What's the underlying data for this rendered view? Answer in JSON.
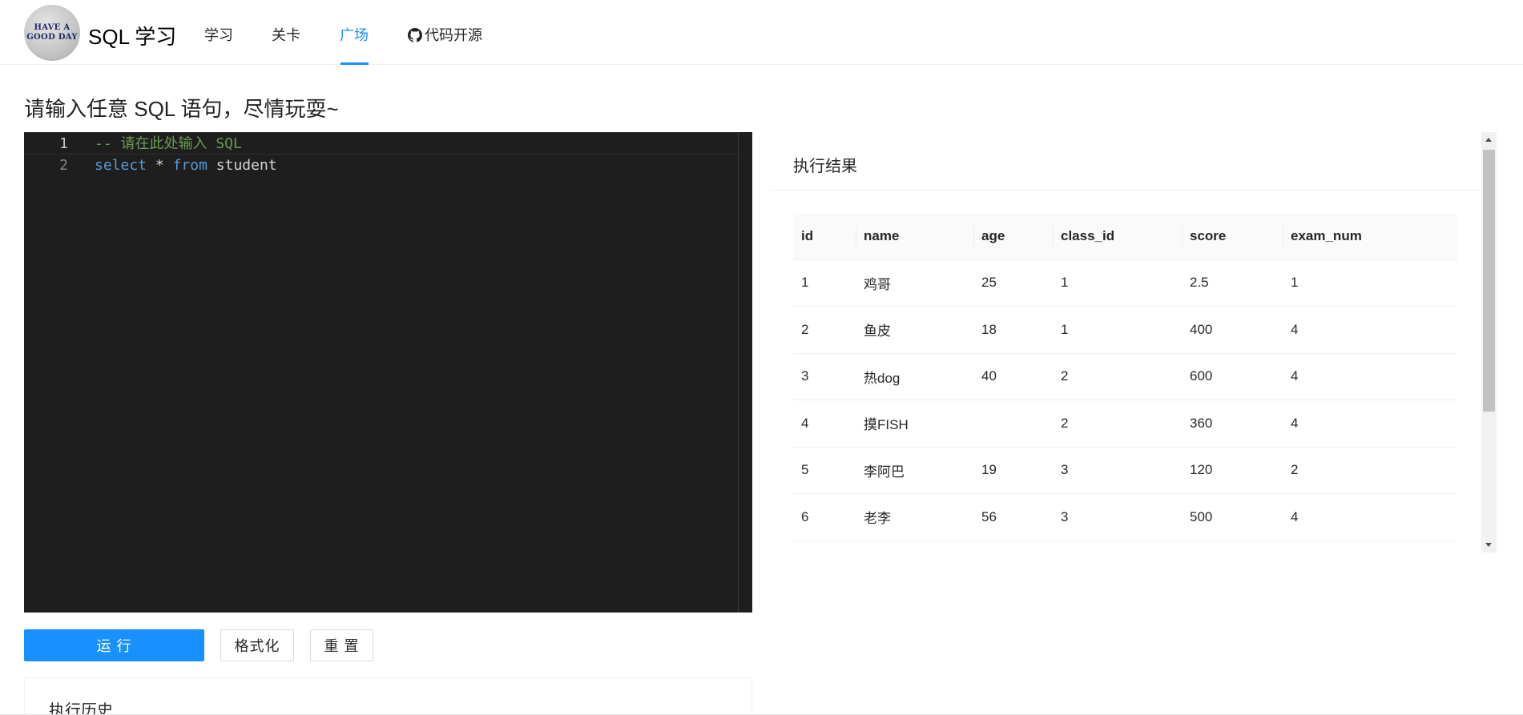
{
  "header": {
    "logo_text_line1": "HAVE A",
    "logo_text_line2": "GOOD DAY",
    "app_title": "SQL 学习",
    "nav": [
      {
        "label": "学习"
      },
      {
        "label": "关卡"
      },
      {
        "label": "广场",
        "active": true
      },
      {
        "label": "代码开源",
        "icon": "github-icon"
      }
    ]
  },
  "page": {
    "title": "请输入任意 SQL 语句，尽情玩耍~"
  },
  "editor": {
    "lines": [
      {
        "number": "1",
        "text": "-- 请在此处输入 SQL"
      },
      {
        "number": "2",
        "keyword1": "select",
        "operator": "*",
        "keyword2": "from",
        "identifier": "student"
      }
    ]
  },
  "actions": {
    "run": "运 行",
    "format": "格式化",
    "reset": "重 置"
  },
  "history": {
    "title": "执行历史"
  },
  "result": {
    "title": "执行结果",
    "columns": [
      "id",
      "name",
      "age",
      "class_id",
      "score",
      "exam_num"
    ],
    "rows": [
      [
        "1",
        "鸡哥",
        "25",
        "1",
        "2.5",
        "1"
      ],
      [
        "2",
        "鱼皮",
        "18",
        "1",
        "400",
        "4"
      ],
      [
        "3",
        "热dog",
        "40",
        "2",
        "600",
        "4"
      ],
      [
        "4",
        "摸FISH",
        "",
        "2",
        "360",
        "4"
      ],
      [
        "5",
        "李阿巴",
        "19",
        "3",
        "120",
        "2"
      ],
      [
        "6",
        "老李",
        "56",
        "3",
        "500",
        "4"
      ]
    ]
  },
  "colors": {
    "accent": "#1890ff",
    "editor_bg": "#1e1e1e",
    "comment": "#6a9955",
    "keyword": "#569cd6"
  }
}
